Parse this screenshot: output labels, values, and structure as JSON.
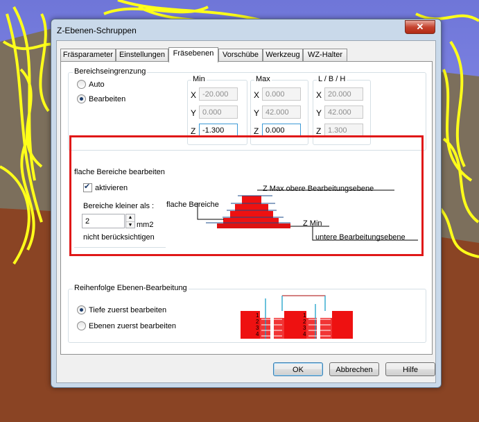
{
  "dialog": {
    "title": "Z-Ebenen-Schruppen",
    "close_label": "✕"
  },
  "tabs": [
    {
      "label": "Fräsparameter",
      "active": false
    },
    {
      "label": "Einstellungen",
      "active": false
    },
    {
      "label": "Fräsebenen",
      "active": true
    },
    {
      "label": "Vorschübe",
      "active": false
    },
    {
      "label": "Werkzeug",
      "active": false
    },
    {
      "label": "WZ-Halter",
      "active": false
    }
  ],
  "bereich": {
    "label": "Bereichseingrenzung",
    "auto_label": "Auto",
    "bearbeiten_label": "Bearbeiten",
    "selected": "Bearbeiten",
    "min": {
      "label": "Min",
      "x": "-20.000",
      "y": "0.000",
      "z": "-1.300"
    },
    "max": {
      "label": "Max",
      "x": "0.000",
      "y": "42.000",
      "z": "0.000"
    },
    "lbh": {
      "label": "L / B / H",
      "x": "20.000",
      "y": "42.000",
      "z": "1.300"
    },
    "axes": {
      "x": "X",
      "y": "Y",
      "z": "Z"
    }
  },
  "flach": {
    "label": "flache Bereiche bearbeiten",
    "aktivieren_label": "aktivieren",
    "aktivieren_checked": true,
    "kleiner_label": "Bereiche kleiner als :",
    "kleiner_value": "2",
    "unit": "mm2",
    "nicht_label": "nicht berücksichtigen",
    "diagram": {
      "zmax": "Z Max  obere Bearbeitungsebene",
      "flache": "flache Bereiche",
      "zmin": "Z Min",
      "untere": "untere Bearbeitungsebene"
    }
  },
  "reihenfolge": {
    "label": "Reihenfolge Ebenen-Bearbeitung",
    "tiefe_label": "Tiefe zuerst bearbeiten",
    "ebenen_label": "Ebenen zuerst bearbeiten",
    "selected": "Tiefe zuerst bearbeiten",
    "levels": [
      "1",
      "2",
      "3",
      "4"
    ]
  },
  "buttons": {
    "ok": "OK",
    "abbrechen": "Abbrechen",
    "hilfe": "Hilfe"
  }
}
